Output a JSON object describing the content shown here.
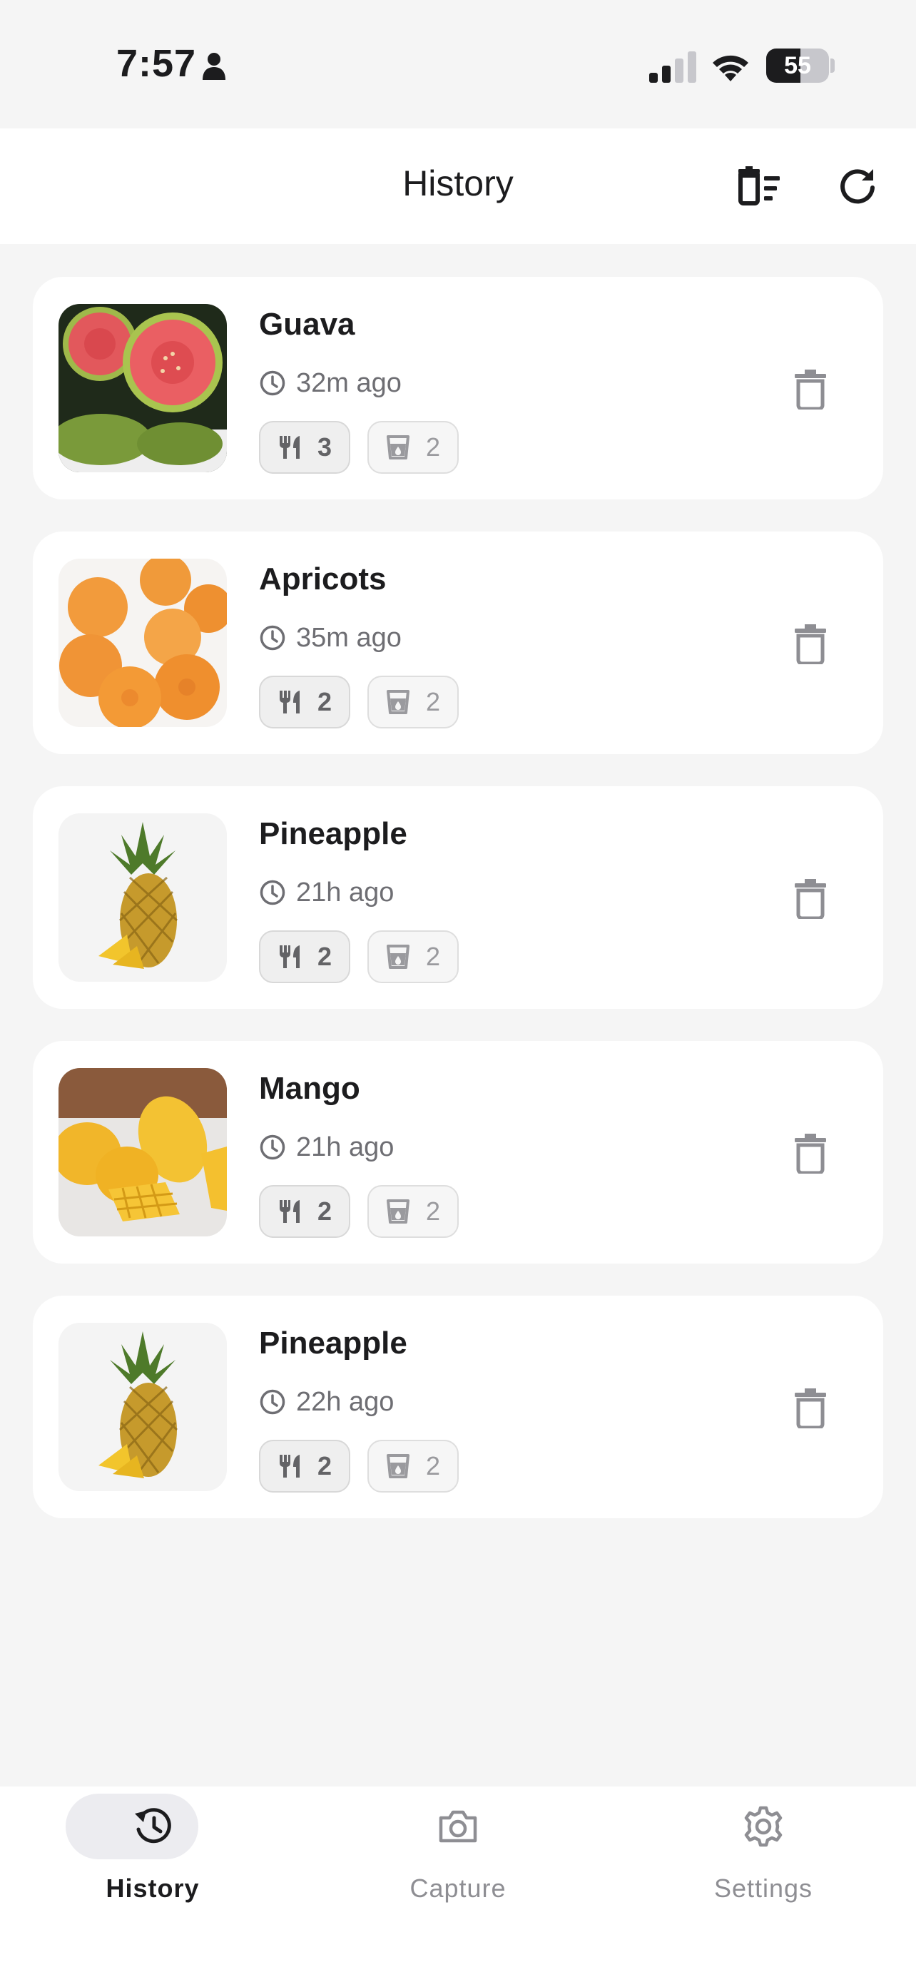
{
  "status_bar": {
    "time": "7:57",
    "battery_percent": 55,
    "battery_label": "55"
  },
  "header": {
    "title": "History",
    "clear_icon": "delete-sweep-icon",
    "refresh_icon": "refresh-icon"
  },
  "items": [
    {
      "title": "Guava",
      "time": "32m ago",
      "servings": "3",
      "cups": "2",
      "image": "guava"
    },
    {
      "title": "Apricots",
      "time": "35m ago",
      "servings": "2",
      "cups": "2",
      "image": "apricots"
    },
    {
      "title": "Pineapple",
      "time": "21h ago",
      "servings": "2",
      "cups": "2",
      "image": "pineapple"
    },
    {
      "title": "Mango",
      "time": "21h ago",
      "servings": "2",
      "cups": "2",
      "image": "mango"
    },
    {
      "title": "Pineapple",
      "time": "22h ago",
      "servings": "2",
      "cups": "2",
      "image": "pineapple"
    }
  ],
  "tabs": [
    {
      "label": "History",
      "icon": "history-icon",
      "active": true
    },
    {
      "label": "Capture",
      "icon": "camera-icon",
      "active": false
    },
    {
      "label": "Settings",
      "icon": "gear-icon",
      "active": false
    }
  ],
  "colors": {
    "background": "#f5f5f5",
    "card": "#ffffff",
    "text_primary": "#1c1c1e",
    "text_secondary": "#6e6e73",
    "tab_inactive": "#8e8e93",
    "tab_active_pill": "#ececf0"
  }
}
